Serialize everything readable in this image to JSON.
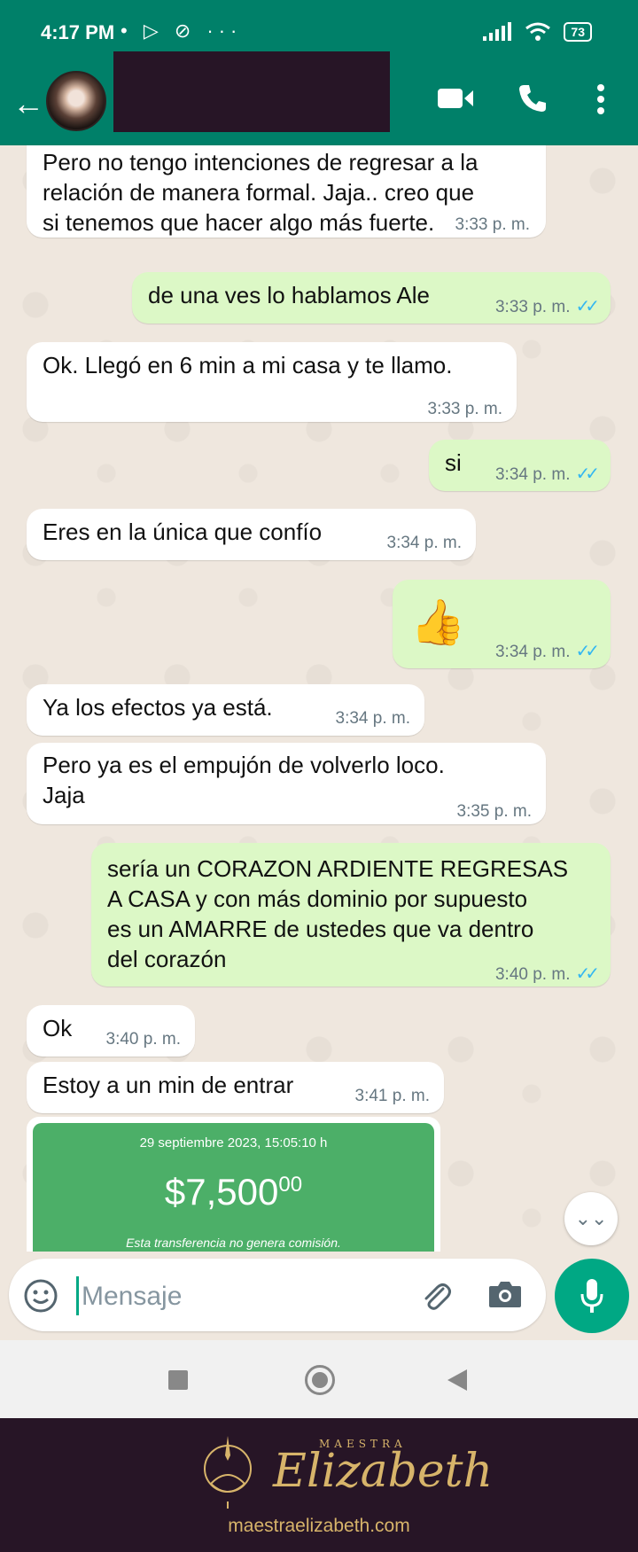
{
  "status_bar": {
    "time": "4:17 PM",
    "icons_text": "• ▷ ⊘ ···",
    "battery": "73"
  },
  "header": {
    "back_icon": "back-arrow-icon",
    "video_icon": "video-call-icon",
    "call_icon": "phone-icon",
    "menu_icon": "more-vert-icon"
  },
  "messages": [
    {
      "dir": "in",
      "text": "Pero no tengo intenciones de regresar a la\nrelación de manera formal. Jaja.. creo que\nsi tenemos que hacer algo más fuerte.",
      "time": "3:33 p. m."
    },
    {
      "dir": "out",
      "text": "de una ves lo hablamos Ale",
      "time": "3:33 p. m.",
      "read": true
    },
    {
      "dir": "in",
      "text": "Ok. Llegó en 6 min a mi casa y te llamo.",
      "time": "3:33 p. m."
    },
    {
      "dir": "out",
      "text": "si",
      "time": "3:34 p. m.",
      "read": true
    },
    {
      "dir": "in",
      "text": "Eres en la única que confío",
      "time": "3:34 p. m."
    },
    {
      "dir": "out",
      "text": "👍",
      "time": "3:34 p. m.",
      "read": true
    },
    {
      "dir": "in",
      "text": "Ya los efectos ya está.",
      "time": "3:34 p. m."
    },
    {
      "dir": "in",
      "text": "Pero ya es el empujón de volverlo loco.\nJaja",
      "time": "3:35 p. m."
    },
    {
      "dir": "out",
      "text": "sería un CORAZON ARDIENTE REGRESAS\nA CASA y con más dominio por supuesto\nes un AMARRE de ustedes que va dentro\ndel corazón",
      "time": "3:40 p. m.",
      "read": true
    },
    {
      "dir": "in",
      "text": "Ok",
      "time": "3:40 p. m."
    },
    {
      "dir": "in",
      "text": "Estoy a un min de entrar",
      "time": "3:41 p. m."
    }
  ],
  "receipt": {
    "date": "29 septiembre 2023, 15:05:10 h",
    "amount": "$7,500",
    "cents": "00",
    "note": "Esta transferencia no genera comisión."
  },
  "composer": {
    "placeholder": "Mensaje",
    "value": ""
  },
  "banner": {
    "prefix": "MAESTRA",
    "brand": "Elizabeth",
    "url": "maestraelizabeth.com"
  },
  "colors": {
    "header": "#008069",
    "outgoing": "#dcf8c6",
    "accent": "#00a884",
    "banner": "#271526",
    "gold": "#d7b46a"
  }
}
